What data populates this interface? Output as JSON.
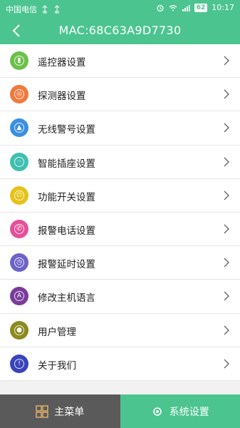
{
  "status": {
    "carrier": "中国电信",
    "battery": "62",
    "time": "10:17"
  },
  "header": {
    "title": "MAC:68C63A9D7730"
  },
  "menu": [
    {
      "label": "遥控器设置",
      "icon": "remote-icon",
      "color": "#6cc04a"
    },
    {
      "label": "探测器设置",
      "icon": "detector-icon",
      "color": "#ee7a3c"
    },
    {
      "label": "无线警号设置",
      "icon": "siren-icon",
      "color": "#3a8fe0"
    },
    {
      "label": "智能插座设置",
      "icon": "socket-icon",
      "color": "#3fbfb0"
    },
    {
      "label": "功能开关设置",
      "icon": "power-icon",
      "color": "#e6c21a"
    },
    {
      "label": "报警电话设置",
      "icon": "phone-icon",
      "color": "#e6509a"
    },
    {
      "label": "报警延时设置",
      "icon": "delay-icon",
      "color": "#6c62c8"
    },
    {
      "label": "修改主机语言",
      "icon": "language-icon",
      "color": "#7a3c9a"
    },
    {
      "label": "用户管理",
      "icon": "user-icon",
      "color": "#8a8a1e"
    },
    {
      "label": "关于我们",
      "icon": "info-icon",
      "color": "#3844b8"
    }
  ],
  "tabbar": {
    "main_label": "主菜单",
    "sys_label": "系统设置"
  }
}
